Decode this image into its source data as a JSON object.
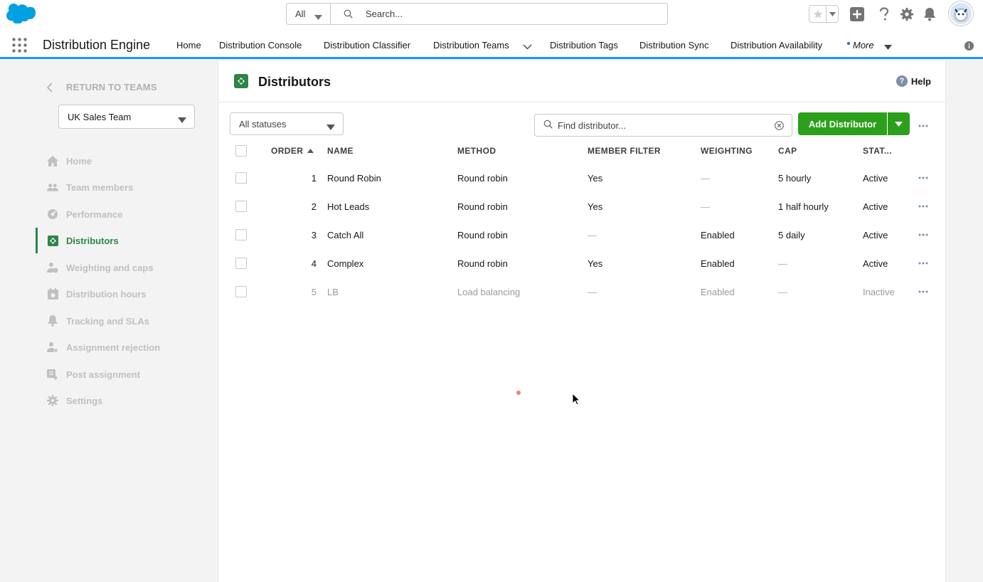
{
  "header": {
    "search_scope": "All",
    "search_placeholder": "Search..."
  },
  "nav": {
    "app_name": "Distribution Engine",
    "items": [
      "Home",
      "Distribution Console",
      "Distribution Classifier",
      "Distribution Teams",
      "Distribution Tags",
      "Distribution Sync",
      "Distribution Availability"
    ],
    "more": "More"
  },
  "sidebar": {
    "return_label": "RETURN TO TEAMS",
    "team": "UK Sales Team",
    "items": [
      "Home",
      "Team members",
      "Performance",
      "Distributors",
      "Weighting and caps",
      "Distribution hours",
      "Tracking and SLAs",
      "Assignment rejection",
      "Post assignment",
      "Settings"
    ],
    "active": "Distributors"
  },
  "main": {
    "title": "Distributors",
    "help": "Help",
    "status_filter": "All statuses",
    "find_placeholder": "Find distributor...",
    "add_button": "Add Distributor",
    "columns": [
      "ORDER",
      "NAME",
      "METHOD",
      "MEMBER FILTER",
      "WEIGHTING",
      "CAP",
      "STAT..."
    ],
    "rows": [
      {
        "order": "1",
        "name": "Round Robin",
        "method": "Round robin",
        "member_filter": "Yes",
        "weighting": "—",
        "cap": "5 hourly",
        "status": "Active"
      },
      {
        "order": "2",
        "name": "Hot Leads",
        "method": "Round robin",
        "member_filter": "Yes",
        "weighting": "—",
        "cap": "1 half hourly",
        "status": "Active"
      },
      {
        "order": "3",
        "name": "Catch All",
        "method": "Round robin",
        "member_filter": "—",
        "weighting": "Enabled",
        "cap": "5 daily",
        "status": "Active"
      },
      {
        "order": "4",
        "name": "Complex",
        "method": "Round robin",
        "member_filter": "Yes",
        "weighting": "Enabled",
        "cap": "—",
        "status": "Active"
      },
      {
        "order": "5",
        "name": "LB",
        "method": "Load balancing",
        "member_filter": "—",
        "weighting": "Enabled",
        "cap": "—",
        "status": "Inactive"
      }
    ]
  },
  "colors": {
    "accent_blue": "#1b96ff",
    "brand_green": "#2ca01c",
    "active_green": "#2e844a"
  }
}
